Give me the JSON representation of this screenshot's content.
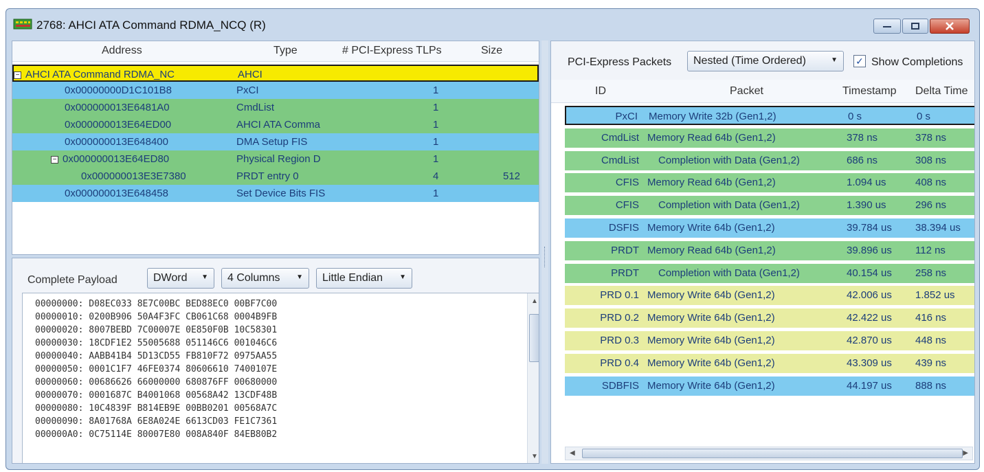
{
  "window": {
    "title": "2768: AHCI ATA Command RDMA_NCQ (R)"
  },
  "tree": {
    "headers": {
      "address": "Address",
      "type": "Type",
      "tlps": "# PCI-Express TLPs",
      "size": "Size"
    },
    "rows": [
      {
        "address": "AHCI ATA Command RDMA_NC",
        "type": "AHCI",
        "tlps": "",
        "size": "",
        "kind": "yellow",
        "indent": 0,
        "expander": "−"
      },
      {
        "address": "0x00000000D1C101B8",
        "type": "PxCI",
        "tlps": "1",
        "size": "",
        "kind": "blue",
        "indent": 1,
        "expander": ""
      },
      {
        "address": "0x000000013E6481A0",
        "type": "CmdList",
        "tlps": "1",
        "size": "",
        "kind": "green",
        "indent": 1,
        "expander": ""
      },
      {
        "address": "0x000000013E64ED00",
        "type": "AHCI ATA Comma",
        "tlps": "1",
        "size": "",
        "kind": "green",
        "indent": 1,
        "expander": ""
      },
      {
        "address": "0x000000013E648400",
        "type": "DMA Setup FIS",
        "tlps": "1",
        "size": "",
        "kind": "blue",
        "indent": 1,
        "expander": ""
      },
      {
        "address": "0x000000013E64ED80",
        "type": "Physical Region D",
        "tlps": "1",
        "size": "",
        "kind": "green",
        "indent": 1,
        "expander": "−"
      },
      {
        "address": "0x000000013E3E7380",
        "type": "PRDT entry 0",
        "tlps": "4",
        "size": "512",
        "kind": "green",
        "indent": 2,
        "expander": ""
      },
      {
        "address": "0x000000013E648458",
        "type": "Set Device Bits FIS",
        "tlps": "1",
        "size": "",
        "kind": "blue",
        "indent": 1,
        "expander": ""
      }
    ]
  },
  "payload": {
    "label": "Complete Payload",
    "format": "DWord",
    "columns": "4 Columns",
    "endian": "Little Endian",
    "lines": [
      "00000000: D08EC033 8E7C00BC BED88EC0 00BF7C00",
      "00000010: 0200B906 50A4F3FC CB061C68 0004B9FB",
      "00000020: 8007BEBD 7C00007E 0E850F0B 10C58301",
      "00000030: 18CDF1E2 55005688 051146C6 001046C6",
      "00000040: AABB41B4 5D13CD55 FB810F72 0975AA55",
      "00000050: 0001C1F7 46FE0374 80606610 7400107E",
      "00000060: 00686626 66000000 680876FF 00680000",
      "00000070: 0001687C B4001068 00568A42 13CDF48B",
      "00000080: 10C4839F B814EB9E 00BB0201 00568A7C",
      "00000090: 8A01768A 6E8A024E 6613CD03 FE1C7361",
      "000000A0: 0C75114E 80007E80 008A840F 84EB80B2"
    ]
  },
  "packets": {
    "label": "PCI-Express Packets",
    "view_mode": "Nested (Time Ordered)",
    "show_completions_label": "Show Completions",
    "show_completions_checked": true,
    "headers": {
      "id": "ID",
      "packet": "Packet",
      "timestamp": "Timestamp",
      "delta": "Delta Time"
    },
    "rows": [
      {
        "id": "PxCI",
        "packet": "Memory Write 32b (Gen1,2)",
        "timestamp": "0 s",
        "delta": "0 s",
        "kind": "blue",
        "selected": true,
        "indent": 0
      },
      {
        "id": "CmdList",
        "packet": "Memory Read 64b (Gen1,2)",
        "timestamp": "378 ns",
        "delta": "378 ns",
        "kind": "green",
        "selected": false,
        "indent": 0
      },
      {
        "id": "CmdList",
        "packet": "Completion with Data (Gen1,2)",
        "timestamp": "686 ns",
        "delta": "308 ns",
        "kind": "green",
        "selected": false,
        "indent": 1
      },
      {
        "id": "CFIS",
        "packet": "Memory Read 64b (Gen1,2)",
        "timestamp": "1.094 us",
        "delta": "408 ns",
        "kind": "green",
        "selected": false,
        "indent": 0
      },
      {
        "id": "CFIS",
        "packet": "Completion with Data (Gen1,2)",
        "timestamp": "1.390 us",
        "delta": "296 ns",
        "kind": "green",
        "selected": false,
        "indent": 1
      },
      {
        "id": "DSFIS",
        "packet": "Memory Write 64b (Gen1,2)",
        "timestamp": "39.784 us",
        "delta": "38.394 us",
        "kind": "blue",
        "selected": false,
        "indent": 0
      },
      {
        "id": "PRDT",
        "packet": "Memory Read 64b (Gen1,2)",
        "timestamp": "39.896 us",
        "delta": "112 ns",
        "kind": "green",
        "selected": false,
        "indent": 0
      },
      {
        "id": "PRDT",
        "packet": "Completion with Data (Gen1,2)",
        "timestamp": "40.154 us",
        "delta": "258 ns",
        "kind": "green",
        "selected": false,
        "indent": 1
      },
      {
        "id": "PRD 0.1",
        "packet": "Memory Write 64b (Gen1,2)",
        "timestamp": "42.006 us",
        "delta": "1.852 us",
        "kind": "yellow",
        "selected": false,
        "indent": 0
      },
      {
        "id": "PRD 0.2",
        "packet": "Memory Write 64b (Gen1,2)",
        "timestamp": "42.422 us",
        "delta": "416 ns",
        "kind": "yellow",
        "selected": false,
        "indent": 0
      },
      {
        "id": "PRD 0.3",
        "packet": "Memory Write 64b (Gen1,2)",
        "timestamp": "42.870 us",
        "delta": "448 ns",
        "kind": "yellow",
        "selected": false,
        "indent": 0
      },
      {
        "id": "PRD 0.4",
        "packet": "Memory Write 64b (Gen1,2)",
        "timestamp": "43.309 us",
        "delta": "439 ns",
        "kind": "yellow",
        "selected": false,
        "indent": 0
      },
      {
        "id": "SDBFIS",
        "packet": "Memory Write 64b (Gen1,2)",
        "timestamp": "44.197 us",
        "delta": "888 ns",
        "kind": "blue",
        "selected": false,
        "indent": 0
      }
    ]
  },
  "colors": {
    "yellow_row": "#f7ea00",
    "blue_row": "#75c6ee",
    "green_row": "#7ec982",
    "pale_yellow_row": "#e8eda2"
  },
  "icons": {
    "app": "pci-analyzer-icon",
    "check": "checkmark-icon",
    "dropdown": "chevron-down-icon"
  }
}
